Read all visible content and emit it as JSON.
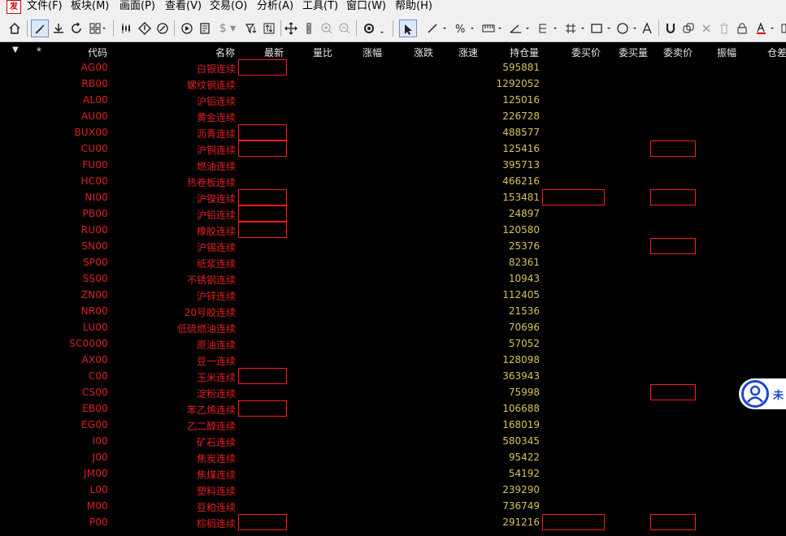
{
  "menu": {
    "items": [
      "文件(F)",
      "板块(M)",
      "画面(P)",
      "查看(V)",
      "交易(O)",
      "分析(A)",
      "工具(T)",
      "窗口(W)",
      "帮助(H)"
    ]
  },
  "grid": {
    "headers": [
      "代码",
      "名称",
      "最新",
      "量比",
      "涨幅",
      "涨跌",
      "涨速",
      "持仓量",
      "委买价",
      "委买量",
      "委卖价",
      "振幅",
      "仓差"
    ],
    "star": "*",
    "rows": [
      {
        "code": "AG00",
        "name": "白银连续",
        "open_interest": "595881"
      },
      {
        "code": "RB00",
        "name": "螺纹钢连续",
        "open_interest": "1292052"
      },
      {
        "code": "AL00",
        "name": "沪铝连续",
        "open_interest": "125016"
      },
      {
        "code": "AU00",
        "name": "黄金连续",
        "open_interest": "226728"
      },
      {
        "code": "BUX00",
        "name": "沥青连续",
        "open_interest": "488577"
      },
      {
        "code": "CU00",
        "name": "沪铜连续",
        "open_interest": "125416"
      },
      {
        "code": "FU00",
        "name": "燃油连续",
        "open_interest": "395713"
      },
      {
        "code": "HC00",
        "name": "热卷板连续",
        "open_interest": "466216"
      },
      {
        "code": "NI00",
        "name": "沪镍连续",
        "open_interest": "153481"
      },
      {
        "code": "PB00",
        "name": "沪铅连续",
        "open_interest": "24897"
      },
      {
        "code": "RU00",
        "name": "橡胶连续",
        "open_interest": "120580"
      },
      {
        "code": "SN00",
        "name": "沪锡连续",
        "open_interest": "25376"
      },
      {
        "code": "SP00",
        "name": "纸浆连续",
        "open_interest": "82361"
      },
      {
        "code": "SS00",
        "name": "不锈钢连续",
        "open_interest": "10943"
      },
      {
        "code": "ZN00",
        "name": "沪锌连续",
        "open_interest": "112405"
      },
      {
        "code": "NR00",
        "name": "20号胶连续",
        "open_interest": "21536"
      },
      {
        "code": "LU00",
        "name": "低硫燃油连续",
        "open_interest": "70696"
      },
      {
        "code": "SC0000",
        "name": "原油连续",
        "open_interest": "57052"
      },
      {
        "code": "AX00",
        "name": "豆一连续",
        "open_interest": "128098"
      },
      {
        "code": "C00",
        "name": "玉米连续",
        "open_interest": "363943"
      },
      {
        "code": "CS00",
        "name": "淀粉连续",
        "open_interest": "75998"
      },
      {
        "code": "EB00",
        "name": "苯乙烯连续",
        "open_interest": "106688"
      },
      {
        "code": "EG00",
        "name": "乙二醇连续",
        "open_interest": "168019"
      },
      {
        "code": "I00",
        "name": "矿石连续",
        "open_interest": "580345"
      },
      {
        "code": "J00",
        "name": "焦炭连续",
        "open_interest": "95422"
      },
      {
        "code": "JM00",
        "name": "焦煤连续",
        "open_interest": "54192"
      },
      {
        "code": "L00",
        "name": "塑料连续",
        "open_interest": "239290"
      },
      {
        "code": "M00",
        "name": "豆粕连续",
        "open_interest": "736749"
      },
      {
        "code": "P00",
        "name": "棕榈连续",
        "open_interest": "291216"
      }
    ]
  },
  "service_badge": {
    "label": "未"
  },
  "colors": {
    "code": "#e02020",
    "oi": "#d8c25a",
    "box": "#ff1a1a",
    "background": "#000000"
  }
}
